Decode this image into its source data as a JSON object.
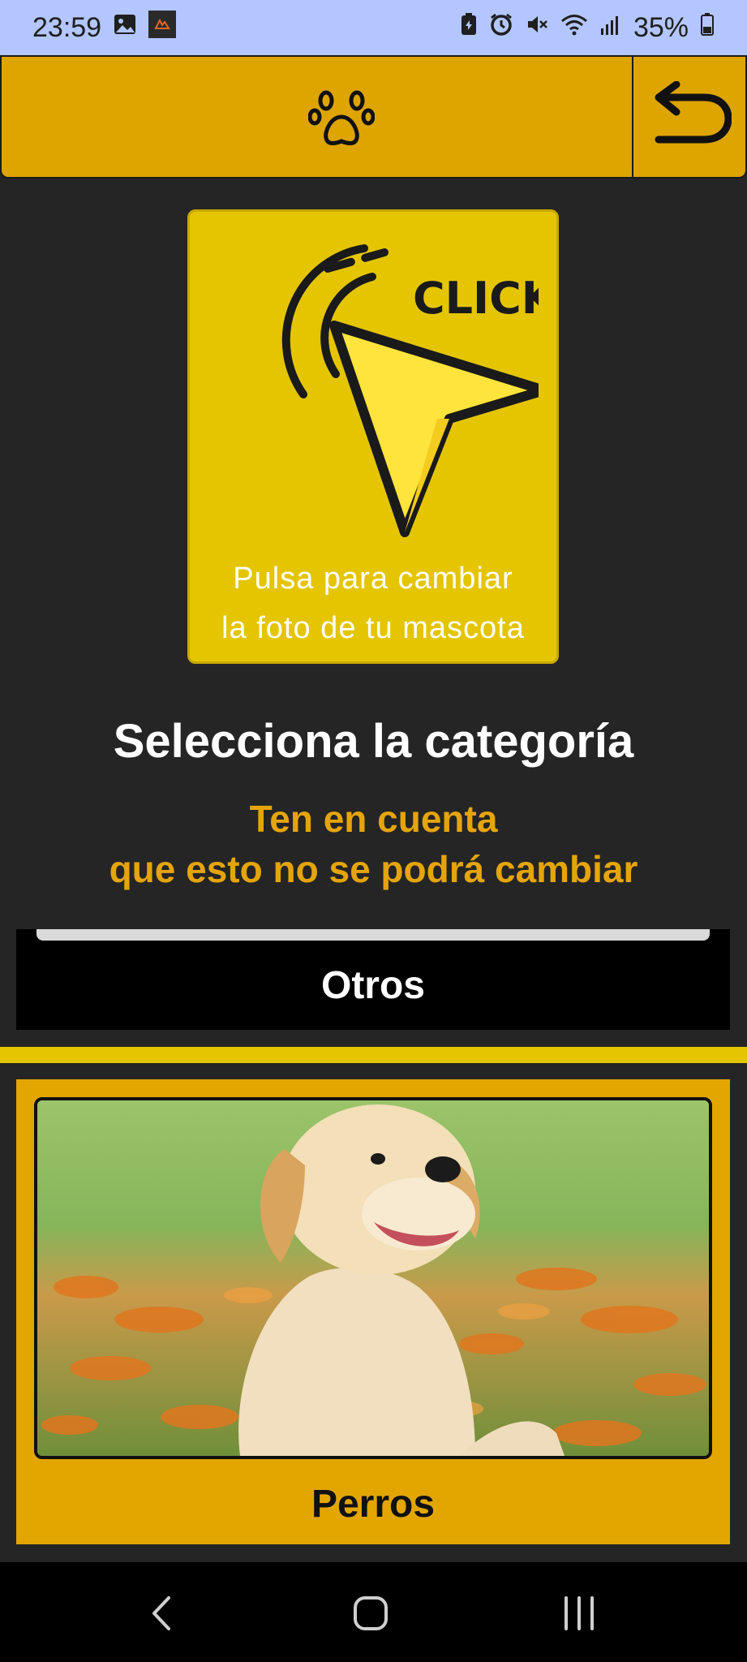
{
  "status_bar": {
    "time": "23:59",
    "battery": "35%",
    "left_icons": [
      "gallery-icon",
      "app-notification-icon"
    ],
    "right_icons": [
      "battery-saver-icon",
      "alarm-icon",
      "mute-icon",
      "wifi-icon",
      "signal-icon",
      "battery-icon"
    ]
  },
  "app_bar": {
    "center_icon": "paw-icon",
    "back_icon": "undo-arrow-icon",
    "color": "#dea400"
  },
  "photo_picker": {
    "art_text": "CLICK!",
    "hint": "Pulsa para cambiar\nla foto de tu mascota",
    "color": "#e4c500"
  },
  "heading": "Selecciona la categoría",
  "warning": "Ten en cuenta\nque esto no se podrá cambiar",
  "categories": [
    {
      "label": "Otros"
    },
    {
      "label": "Perros"
    }
  ],
  "nav_bar": {
    "icons": [
      "back-icon",
      "home-icon",
      "recents-icon"
    ]
  },
  "colors": {
    "background": "#252525",
    "accent": "#e5a50a",
    "status_bar": "#b3c6ff"
  }
}
